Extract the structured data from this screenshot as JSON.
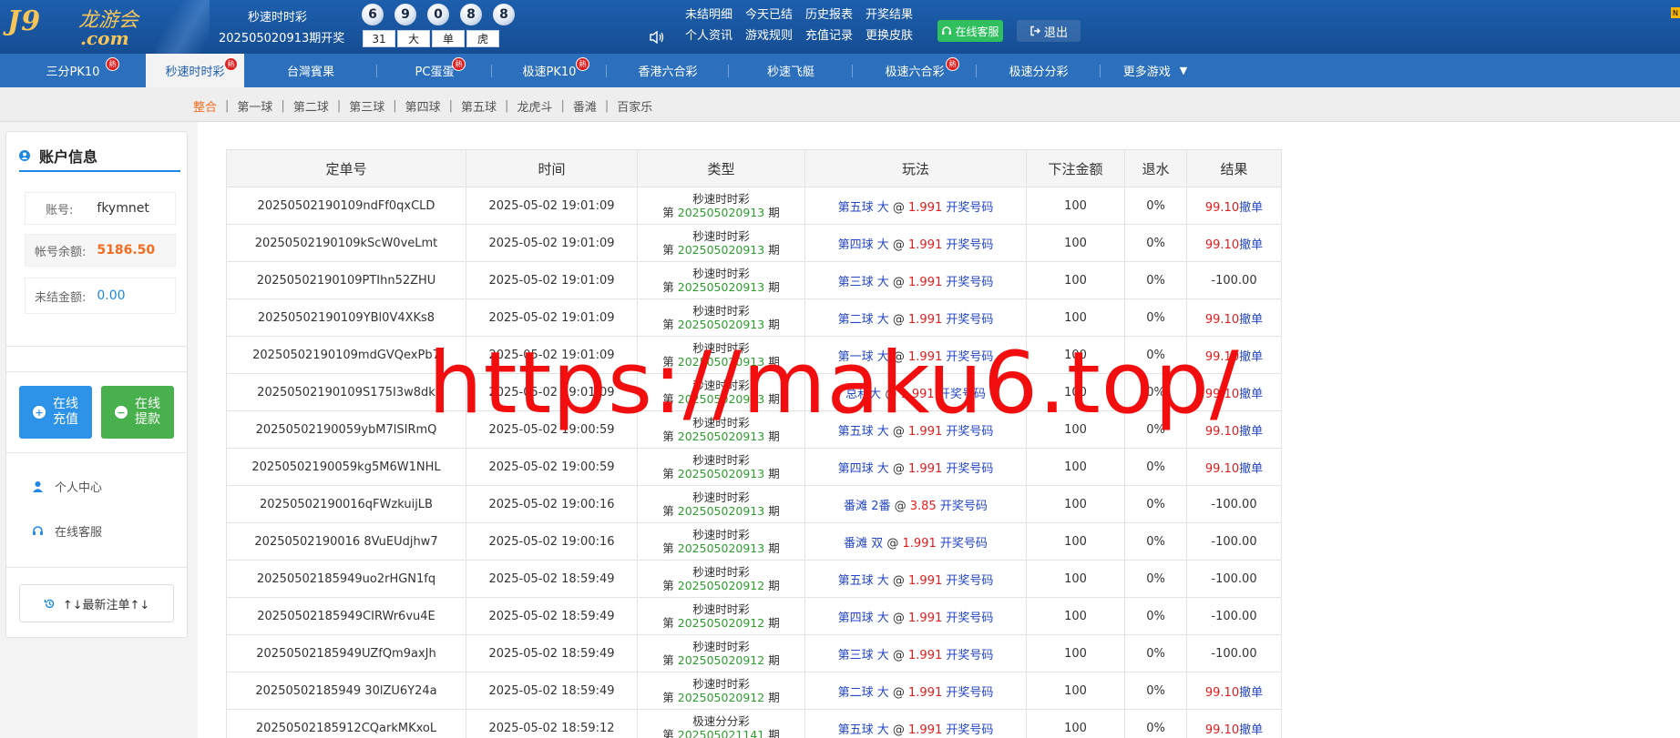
{
  "header": {
    "logo_main": "J9",
    "logo_sub": "龙游会",
    "logo_com": ".com",
    "lottery_name": "秒速时时彩",
    "issue_text": "202505020913期开奖",
    "balls": [
      "6",
      "9",
      "0",
      "8",
      "8"
    ],
    "result_tags": [
      "31",
      "大",
      "单",
      "虎"
    ],
    "top_links": [
      "未结明细",
      "今天已结",
      "历史报表",
      "开奖结果",
      "个人资讯",
      "游戏规则",
      "充值记录",
      "更换皮肤"
    ],
    "customer_service_label": "在线客服",
    "logout_label": "退出",
    "corner_badge": "N"
  },
  "game_nav": {
    "hot_label": "熱",
    "items": [
      {
        "label": "三分PK10",
        "hot": true
      },
      {
        "label": "秒速时时彩",
        "hot": true,
        "active": true
      },
      {
        "label": "台灣賓果",
        "hot": false
      },
      {
        "label": "PC蛋蛋",
        "hot": true
      },
      {
        "label": "极速PK10",
        "hot": true
      },
      {
        "label": "香港六合彩",
        "hot": false
      },
      {
        "label": "秒速飞艇",
        "hot": false
      },
      {
        "label": "极速六合彩",
        "hot": true
      },
      {
        "label": "极速分分彩",
        "hot": false
      },
      {
        "label": "更多游戏",
        "hot": false
      }
    ],
    "more_arrow": "▼"
  },
  "sub_nav": {
    "items": [
      "整合",
      "第一球",
      "第二球",
      "第三球",
      "第四球",
      "第五球",
      "龙虎斗",
      "番滩",
      "百家乐"
    ],
    "separator": "|"
  },
  "account": {
    "title": "账户信息",
    "account_label": "账号:",
    "account_value": "fkymnet",
    "balance_label": "帐号余额:",
    "balance_value": "5186.50",
    "unsettled_label": "未结金额:",
    "unsettled_value": "0.00",
    "deposit_line1": "在线",
    "deposit_line2": "充值",
    "withdraw_line1": "在线",
    "withdraw_line2": "提款",
    "personal_center": "个人中心",
    "online_service": "在线客服",
    "latest_orders": "↑↓最新注单↑↓"
  },
  "table": {
    "headers": [
      "定单号",
      "时间",
      "类型",
      "玩法",
      "下注金额",
      "退水",
      "结果"
    ],
    "issue_prefix": "第",
    "issue_suffix": "期",
    "at_symbol": "@",
    "draw_link": "开奖号码",
    "cancel_label": "撤单",
    "rows": [
      {
        "order": "20250502190109ndFf0qxCLD",
        "time": "2025-05-02 19:01:09",
        "game": "秒速时时彩",
        "issue": "202505020913",
        "play": "第五球 大",
        "odds": "1.991",
        "amount": "100",
        "rebate": "0%",
        "result": "99.10",
        "win": true
      },
      {
        "order": "20250502190109kScW0veLmt",
        "time": "2025-05-02 19:01:09",
        "game": "秒速时时彩",
        "issue": "202505020913",
        "play": "第四球 大",
        "odds": "1.991",
        "amount": "100",
        "rebate": "0%",
        "result": "99.10",
        "win": true
      },
      {
        "order": "20250502190109PTIhn52ZHU",
        "time": "2025-05-02 19:01:09",
        "game": "秒速时时彩",
        "issue": "202505020913",
        "play": "第三球 大",
        "odds": "1.991",
        "amount": "100",
        "rebate": "0%",
        "result": "-100.00",
        "win": false
      },
      {
        "order": "20250502190109YBl0V4XKs8",
        "time": "2025-05-02 19:01:09",
        "game": "秒速时时彩",
        "issue": "202505020913",
        "play": "第二球 大",
        "odds": "1.991",
        "amount": "100",
        "rebate": "0%",
        "result": "99.10",
        "win": true
      },
      {
        "order": "20250502190109mdGVQexPb7",
        "time": "2025-05-02 19:01:09",
        "game": "秒速时时彩",
        "issue": "202505020913",
        "play": "第一球 大",
        "odds": "1.991",
        "amount": "100",
        "rebate": "0%",
        "result": "99.10",
        "win": true
      },
      {
        "order": "20250502190109S175I3w8dk",
        "time": "2025-05-02 19:01:09",
        "game": "秒速时时彩",
        "issue": "202505020913",
        "play": "总和大",
        "odds": "1.991",
        "amount": "100",
        "rebate": "0%",
        "result": "99.10",
        "win": true
      },
      {
        "order": "20250502190059ybM7lSIRmQ",
        "time": "2025-05-02 19:00:59",
        "game": "秒速时时彩",
        "issue": "202505020913",
        "play": "第五球 大",
        "odds": "1.991",
        "amount": "100",
        "rebate": "0%",
        "result": "99.10",
        "win": true
      },
      {
        "order": "20250502190059kg5M6W1NHL",
        "time": "2025-05-02 19:00:59",
        "game": "秒速时时彩",
        "issue": "202505020913",
        "play": "第四球 大",
        "odds": "1.991",
        "amount": "100",
        "rebate": "0%",
        "result": "99.10",
        "win": true
      },
      {
        "order": "20250502190016qFWzkuijLB",
        "time": "2025-05-02 19:00:16",
        "game": "秒速时时彩",
        "issue": "202505020913",
        "play": "番滩 2番",
        "odds": "3.85",
        "amount": "100",
        "rebate": "0%",
        "result": "-100.00",
        "win": false
      },
      {
        "order": "20250502190016 8VuEUdjhw7",
        "time": "2025-05-02 19:00:16",
        "game": "秒速时时彩",
        "issue": "202505020913",
        "play": "番滩 双",
        "odds": "1.991",
        "amount": "100",
        "rebate": "0%",
        "result": "-100.00",
        "win": false
      },
      {
        "order": "20250502185949uo2rHGN1fq",
        "time": "2025-05-02 18:59:49",
        "game": "秒速时时彩",
        "issue": "202505020912",
        "play": "第五球 大",
        "odds": "1.991",
        "amount": "100",
        "rebate": "0%",
        "result": "-100.00",
        "win": false
      },
      {
        "order": "20250502185949CIRWr6vu4E",
        "time": "2025-05-02 18:59:49",
        "game": "秒速时时彩",
        "issue": "202505020912",
        "play": "第四球 大",
        "odds": "1.991",
        "amount": "100",
        "rebate": "0%",
        "result": "-100.00",
        "win": false
      },
      {
        "order": "20250502185949UZfQm9axJh",
        "time": "2025-05-02 18:59:49",
        "game": "秒速时时彩",
        "issue": "202505020912",
        "play": "第三球 大",
        "odds": "1.991",
        "amount": "100",
        "rebate": "0%",
        "result": "-100.00",
        "win": false
      },
      {
        "order": "20250502185949 30lZU6Y24a",
        "time": "2025-05-02 18:59:49",
        "game": "秒速时时彩",
        "issue": "202505020912",
        "play": "第二球 大",
        "odds": "1.991",
        "amount": "100",
        "rebate": "0%",
        "result": "99.10",
        "win": true
      },
      {
        "order": "20250502185912CQarkMKxoL",
        "time": "2025-05-02 18:59:12",
        "game": "极速分分彩",
        "issue": "202505021141",
        "play": "第五球 大",
        "odds": "1.991",
        "amount": "100",
        "rebate": "0%",
        "result": "99.10",
        "win": true
      }
    ]
  },
  "watermark": "https://maku6.top/",
  "colors": {
    "header_blue": "#1d5fae",
    "nav_blue": "#2b6fbd",
    "win_red": "#e51c1c",
    "issue_green": "#2e9d2e",
    "play_blue": "#2446c8",
    "deposit_blue": "#2d93e8",
    "withdraw_green": "#48b04d",
    "balance_orange": "#f26d21"
  }
}
